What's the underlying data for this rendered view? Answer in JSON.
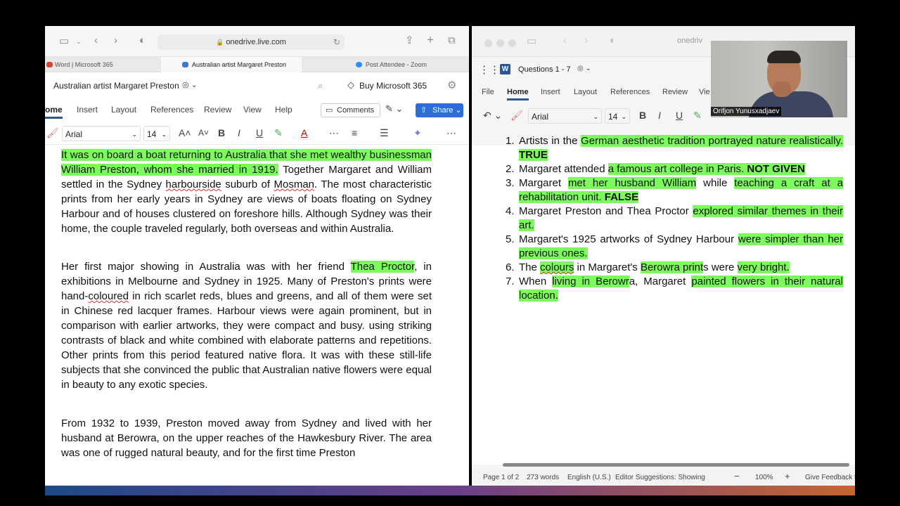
{
  "left": {
    "url": "onedrive.live.com",
    "tabs": [
      {
        "label": "Word | Microsoft 365",
        "color": "#d04a3a"
      },
      {
        "label": "Australian artist Margaret Preston",
        "color": "#3a78d0"
      },
      {
        "label": "Post Attendee - Zoom",
        "color": "#2d8cff"
      }
    ],
    "doc_title": "Australian artist Margaret Preston",
    "buy_label": "Buy Microsoft 365",
    "ribbon_tabs": [
      "ome",
      "Insert",
      "Layout",
      "References",
      "Review",
      "View",
      "Help"
    ],
    "comments_label": "Comments",
    "share_label": "Share",
    "font_name": "Arial",
    "font_size": "14",
    "p1": {
      "hl": "It was on board a boat returning to Australia that she met wealthy businessman William Preston, whom she married in 1919.",
      "a": " Together Margaret and William settled in the Sydney ",
      "w1": "harbourside",
      "b": " suburb of ",
      "w2": "Mosman",
      "c": ". The most characteristic prints from her early years in Sydney are views of boats floating on Sydney Harbour and of houses clustered on foreshore hills. Although Sydney was their home, the couple traveled regularly, both overseas and within Australia."
    },
    "p2": {
      "a": "Her first major showing in Australia was with her friend ",
      "hl": "Thea Proctor",
      "b": ", in exhibitions in Melbourne and Sydney in 1925. Many of Preston's prints were hand-",
      "w1": "coloured",
      "c": " in rich scarlet reds, blues and greens, and all of them were set in Chinese red lacquer frames. Harbour views were again prominent, but in comparison with earlier artworks, they were compact and busy. using striking contrasts of black and white combined with elaborate patterns and repetitions. Other prints from this period featured native flora. It was with these still-life subjects that she convinced the public that Australian native flowers were equal in beauty to any exotic species."
    },
    "p3": "From 1932 to 1939, Preston moved away from Sydney and lived with her husband at Berowra, on the upper reaches of the Hawkesbury River. The area was one of rugged natural beauty, and for the first time Preston"
  },
  "right": {
    "url": "onedriv",
    "doc_title": "Questions 1 - 7",
    "ribbon_tabs": [
      "File",
      "Home",
      "Insert",
      "Layout",
      "References",
      "Review",
      "Vie"
    ],
    "font_name": "Arial",
    "font_size": "14",
    "questions": [
      {
        "num": "1.",
        "t1": "Artists in the ",
        "h1": "German aesthetic tradition portrayed nature realistically.",
        "ans": " TRUE"
      },
      {
        "num": "2.",
        "t1": "Margaret attended ",
        "h1": "a famous art college in Paris.",
        "ans": " NOT GIVEN"
      },
      {
        "num": "3.",
        "t1": "Margaret ",
        "h1": "met her husband William",
        "t2": " while ",
        "h2": "teaching a craft at a rehabilitation unit.",
        "ans": " FALSE"
      },
      {
        "num": "4.",
        "t1": "Margaret Preston and Thea Proctor ",
        "h1": "explored similar themes in their art."
      },
      {
        "num": "5.",
        "t1": "Margaret's 1925 artworks of Sydney Harbour ",
        "h1": "were simpler than her previous ones."
      },
      {
        "num": "6.",
        "t1": "The ",
        "h1": "colours",
        "t2": " in Margaret's ",
        "h2": "Berowra print",
        "t3": "s were ",
        "h3": "very bright."
      },
      {
        "num": "7.",
        "t1": "When ",
        "h1": "living in Berowr",
        "t2": "a, Margaret ",
        "h2": "painted flowers in their natural location."
      }
    ],
    "status": {
      "page": "Page 1 of 2",
      "words": "273 words",
      "lang": "English (U.S.)",
      "editor": "Editor Suggestions: Showing",
      "zoom": "100%",
      "feedback": "Give Feedback to"
    }
  },
  "video": {
    "name": "Orifjon Yunusxadjaev"
  }
}
